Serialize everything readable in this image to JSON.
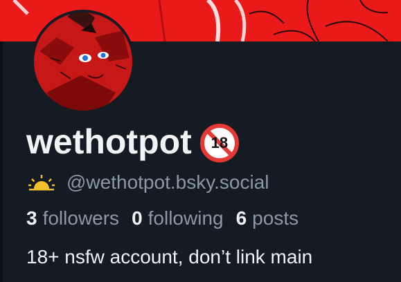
{
  "profile": {
    "display_name": "wethotpot",
    "adult_badge_text": "18",
    "handle": "@wethotpot.bsky.social",
    "bio": "18+ nsfw account, don’t link main"
  },
  "stats": {
    "followers_count": "3",
    "followers_label": "followers",
    "following_count": "0",
    "following_label": "following",
    "posts_count": "6",
    "posts_label": "posts"
  },
  "icons": {
    "banner": "red-banner-art",
    "avatar": "red-creature-avatar",
    "adult_badge": "no-under-18-icon",
    "handle_prefix": "sunrise-icon"
  },
  "colors": {
    "background": "#151b23",
    "banner_red": "#ea1a1a",
    "text_primary": "#f1f3f5",
    "text_secondary": "#8b98a5",
    "badge_red": "#e53935",
    "sun_yellow": "#f2c12e"
  }
}
